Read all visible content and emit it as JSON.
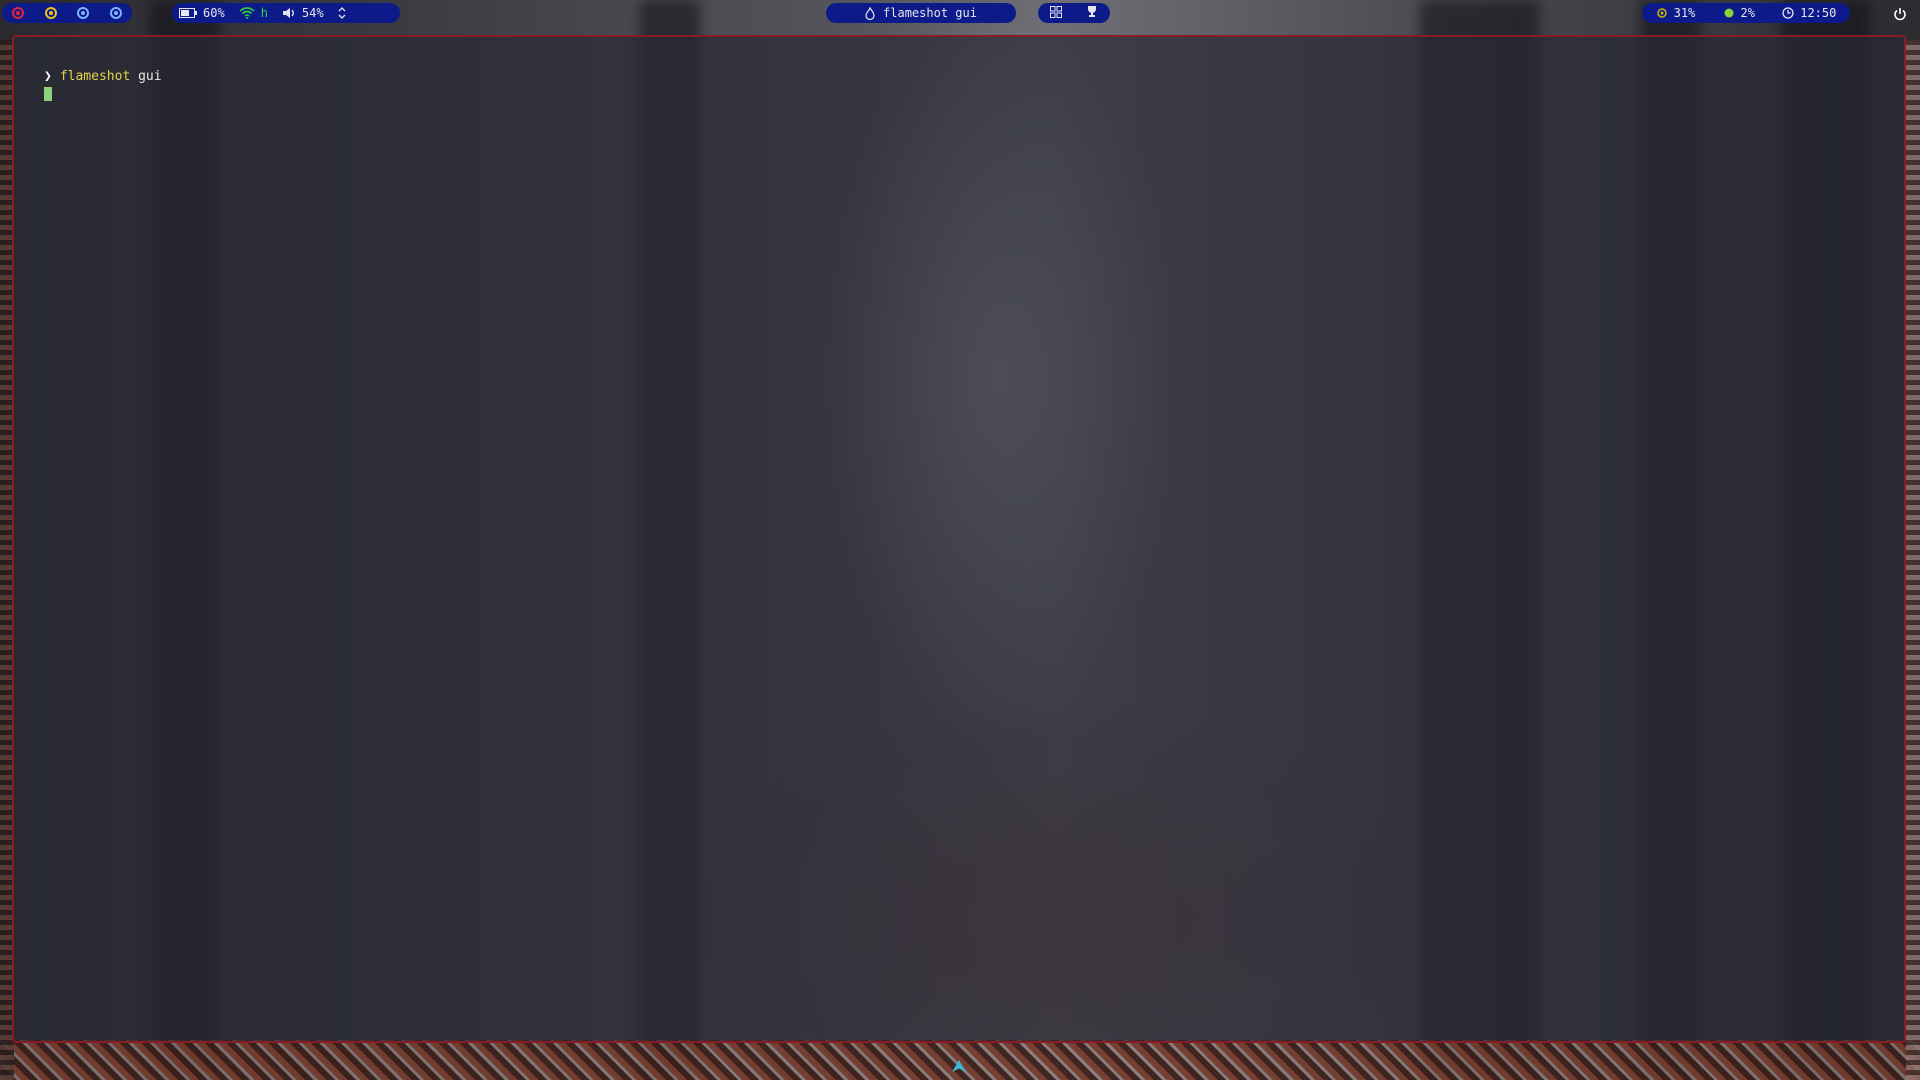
{
  "colors": {
    "bar_bg": "#0d1a8a",
    "border": "#8b1a24",
    "command": "#e6d34a",
    "cursor": "#8fd17a",
    "wifi": "#2ecc40"
  },
  "workspaces": [
    {
      "icon": "workspace-1-icon",
      "color": "#e0243a"
    },
    {
      "icon": "workspace-2-icon",
      "color": "#e8c21a"
    },
    {
      "icon": "workspace-3-icon",
      "color": "#7fb2ff"
    },
    {
      "icon": "workspace-4-icon",
      "color": "#7fb2ff"
    }
  ],
  "status_left": {
    "battery": "60%",
    "wifi": "h",
    "volume": "54%"
  },
  "window_title": "flameshot gui",
  "status_right": {
    "cpu": "31%",
    "mem": "2%",
    "clock": "12:50"
  },
  "terminal": {
    "prompt_symbol": "❯",
    "command": "flameshot",
    "argument": "gui"
  }
}
